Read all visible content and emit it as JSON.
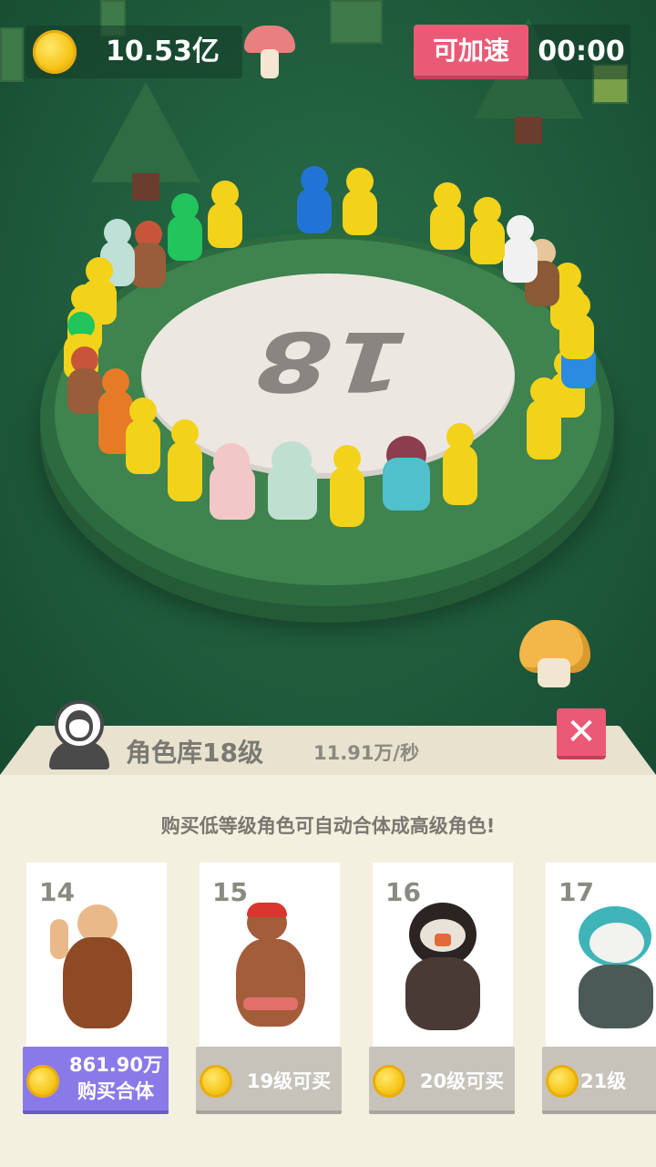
{
  "hud": {
    "coins": "10.53亿",
    "speed_button": "可加速",
    "timer": "00:00"
  },
  "scene": {
    "platform_number": "18"
  },
  "panel": {
    "title": "角色库18级",
    "rate": "11.91万/秒",
    "close_glyph": "✕",
    "hint": "购买低等级角色可自动合体成高级角色!"
  },
  "cards": [
    {
      "level": "14",
      "price": "861.90万",
      "action": "购买合体",
      "state": "available"
    },
    {
      "level": "15",
      "label": "19级可买",
      "state": "locked"
    },
    {
      "level": "16",
      "label": "20级可买",
      "state": "locked"
    },
    {
      "level": "17",
      "label": "21级",
      "state": "locked"
    }
  ],
  "colors": {
    "accent_pink": "#ea5a76",
    "buy_purple": "#8a7ae8",
    "locked_gray": "#c7c3bb",
    "coin_gold": "#f6c51a"
  },
  "icons": [
    "coin-icon",
    "mushroom",
    "avatar-icon",
    "close-icon"
  ]
}
